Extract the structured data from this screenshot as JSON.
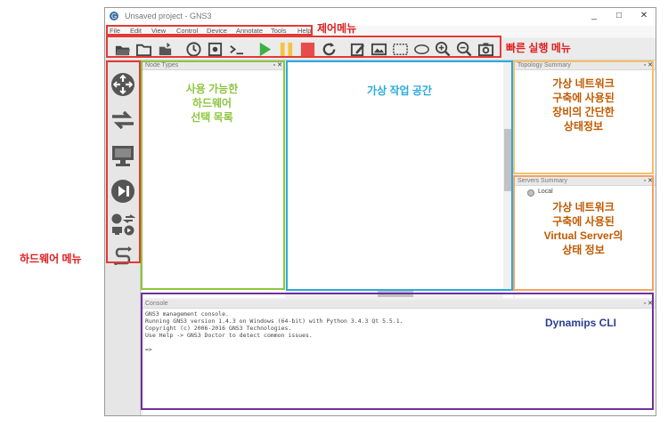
{
  "window": {
    "title": "Unsaved project - GNS3",
    "controls": {
      "minimize": "_",
      "maximize": "□",
      "close": "✕"
    }
  },
  "menu": {
    "items": [
      "File",
      "Edit",
      "View",
      "Control",
      "Device",
      "Annotate",
      "Tools",
      "Help"
    ]
  },
  "toolbar": {
    "icons": [
      "folder-open-icon",
      "folder-icon",
      "save-icon",
      "clock-icon",
      "screenshot-icon",
      "terminal-icon",
      "play-icon",
      "pause-icon",
      "stop-icon",
      "reload-icon",
      "note-icon",
      "image-icon",
      "rectangle-icon",
      "ellipse-icon",
      "zoom-in-icon",
      "zoom-out-icon",
      "camera-icon"
    ]
  },
  "sidebar": {
    "icons": [
      "router-icon",
      "switch-icon",
      "end-device-icon",
      "security-device-icon",
      "all-devices-icon",
      "link-cable-icon"
    ]
  },
  "panels": {
    "node_types": {
      "title": "Node Types"
    },
    "topology_summary": {
      "title": "Topology Summary"
    },
    "servers_summary": {
      "title": "Servers Summary",
      "server": "Local"
    },
    "console": {
      "title": "Console",
      "lines": [
        "GNS3 management console.",
        "Running GNS3 version 1.4.3 on Windows (64-bit) with Python 3.4.3 Qt 5.5.1.",
        "Copyright (c) 2006-2016 GNS3 Technologies.",
        "Use Help -> GNS3 Doctor to detect common issues.",
        "",
        "=>"
      ]
    }
  },
  "annotations": {
    "control_menu": "제어메뉴",
    "quick_menu": "빠른 실행 메뉴",
    "hardware_menu": "하드웨어 메뉴",
    "hardware_list": [
      "사용 가능한",
      "하드웨어",
      "선택 목록"
    ],
    "workspace": "가상 작업 공간",
    "topology_desc": [
      "가상 네트워크",
      "구축에 사용된",
      "장비의 간단한",
      "상태정보"
    ],
    "server_desc": [
      "가상 네트워크",
      "구축에 사용된",
      "Virtual Server의",
      "상태 정보"
    ],
    "cli": "Dynamips CLI"
  },
  "colors": {
    "annotation_red": "#e02020",
    "green": "#8dc63f",
    "blue": "#29aae1",
    "orange": "#f4a261",
    "purple": "#7030a0",
    "dark_orange": "#c05a00"
  }
}
